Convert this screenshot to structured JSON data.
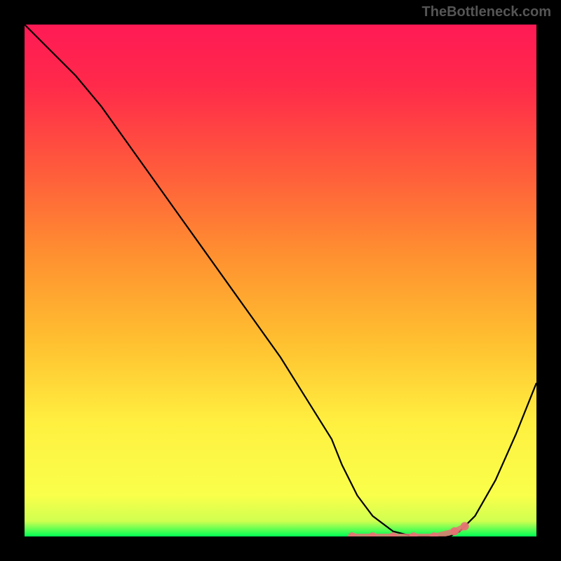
{
  "watermark": "TheBottleneck.com",
  "chart_data": {
    "type": "line",
    "title": "",
    "xlabel": "",
    "ylabel": "",
    "xlim": [
      0,
      100
    ],
    "ylim": [
      0,
      100
    ],
    "x": [
      0,
      5,
      10,
      15,
      20,
      25,
      30,
      35,
      40,
      45,
      50,
      55,
      60,
      62,
      65,
      68,
      72,
      76,
      80,
      83,
      85,
      88,
      92,
      96,
      100
    ],
    "values": [
      100,
      95,
      90,
      84,
      77,
      70,
      63,
      56,
      49,
      42,
      35,
      27,
      19,
      14,
      8,
      4,
      1,
      0,
      0,
      0,
      1,
      4,
      11,
      20,
      30
    ],
    "markers": {
      "x": [
        64,
        68,
        72,
        76,
        80,
        84,
        86
      ],
      "y": [
        0,
        0,
        0,
        0,
        0,
        1,
        2
      ]
    },
    "gradient_stops": [
      {
        "offset": 0,
        "color": "#ff1744"
      },
      {
        "offset": 25,
        "color": "#ff5a3c"
      },
      {
        "offset": 50,
        "color": "#ffb030"
      },
      {
        "offset": 75,
        "color": "#fff040"
      },
      {
        "offset": 95,
        "color": "#f9ff4a"
      },
      {
        "offset": 100,
        "color": "#00ff55"
      }
    ]
  }
}
